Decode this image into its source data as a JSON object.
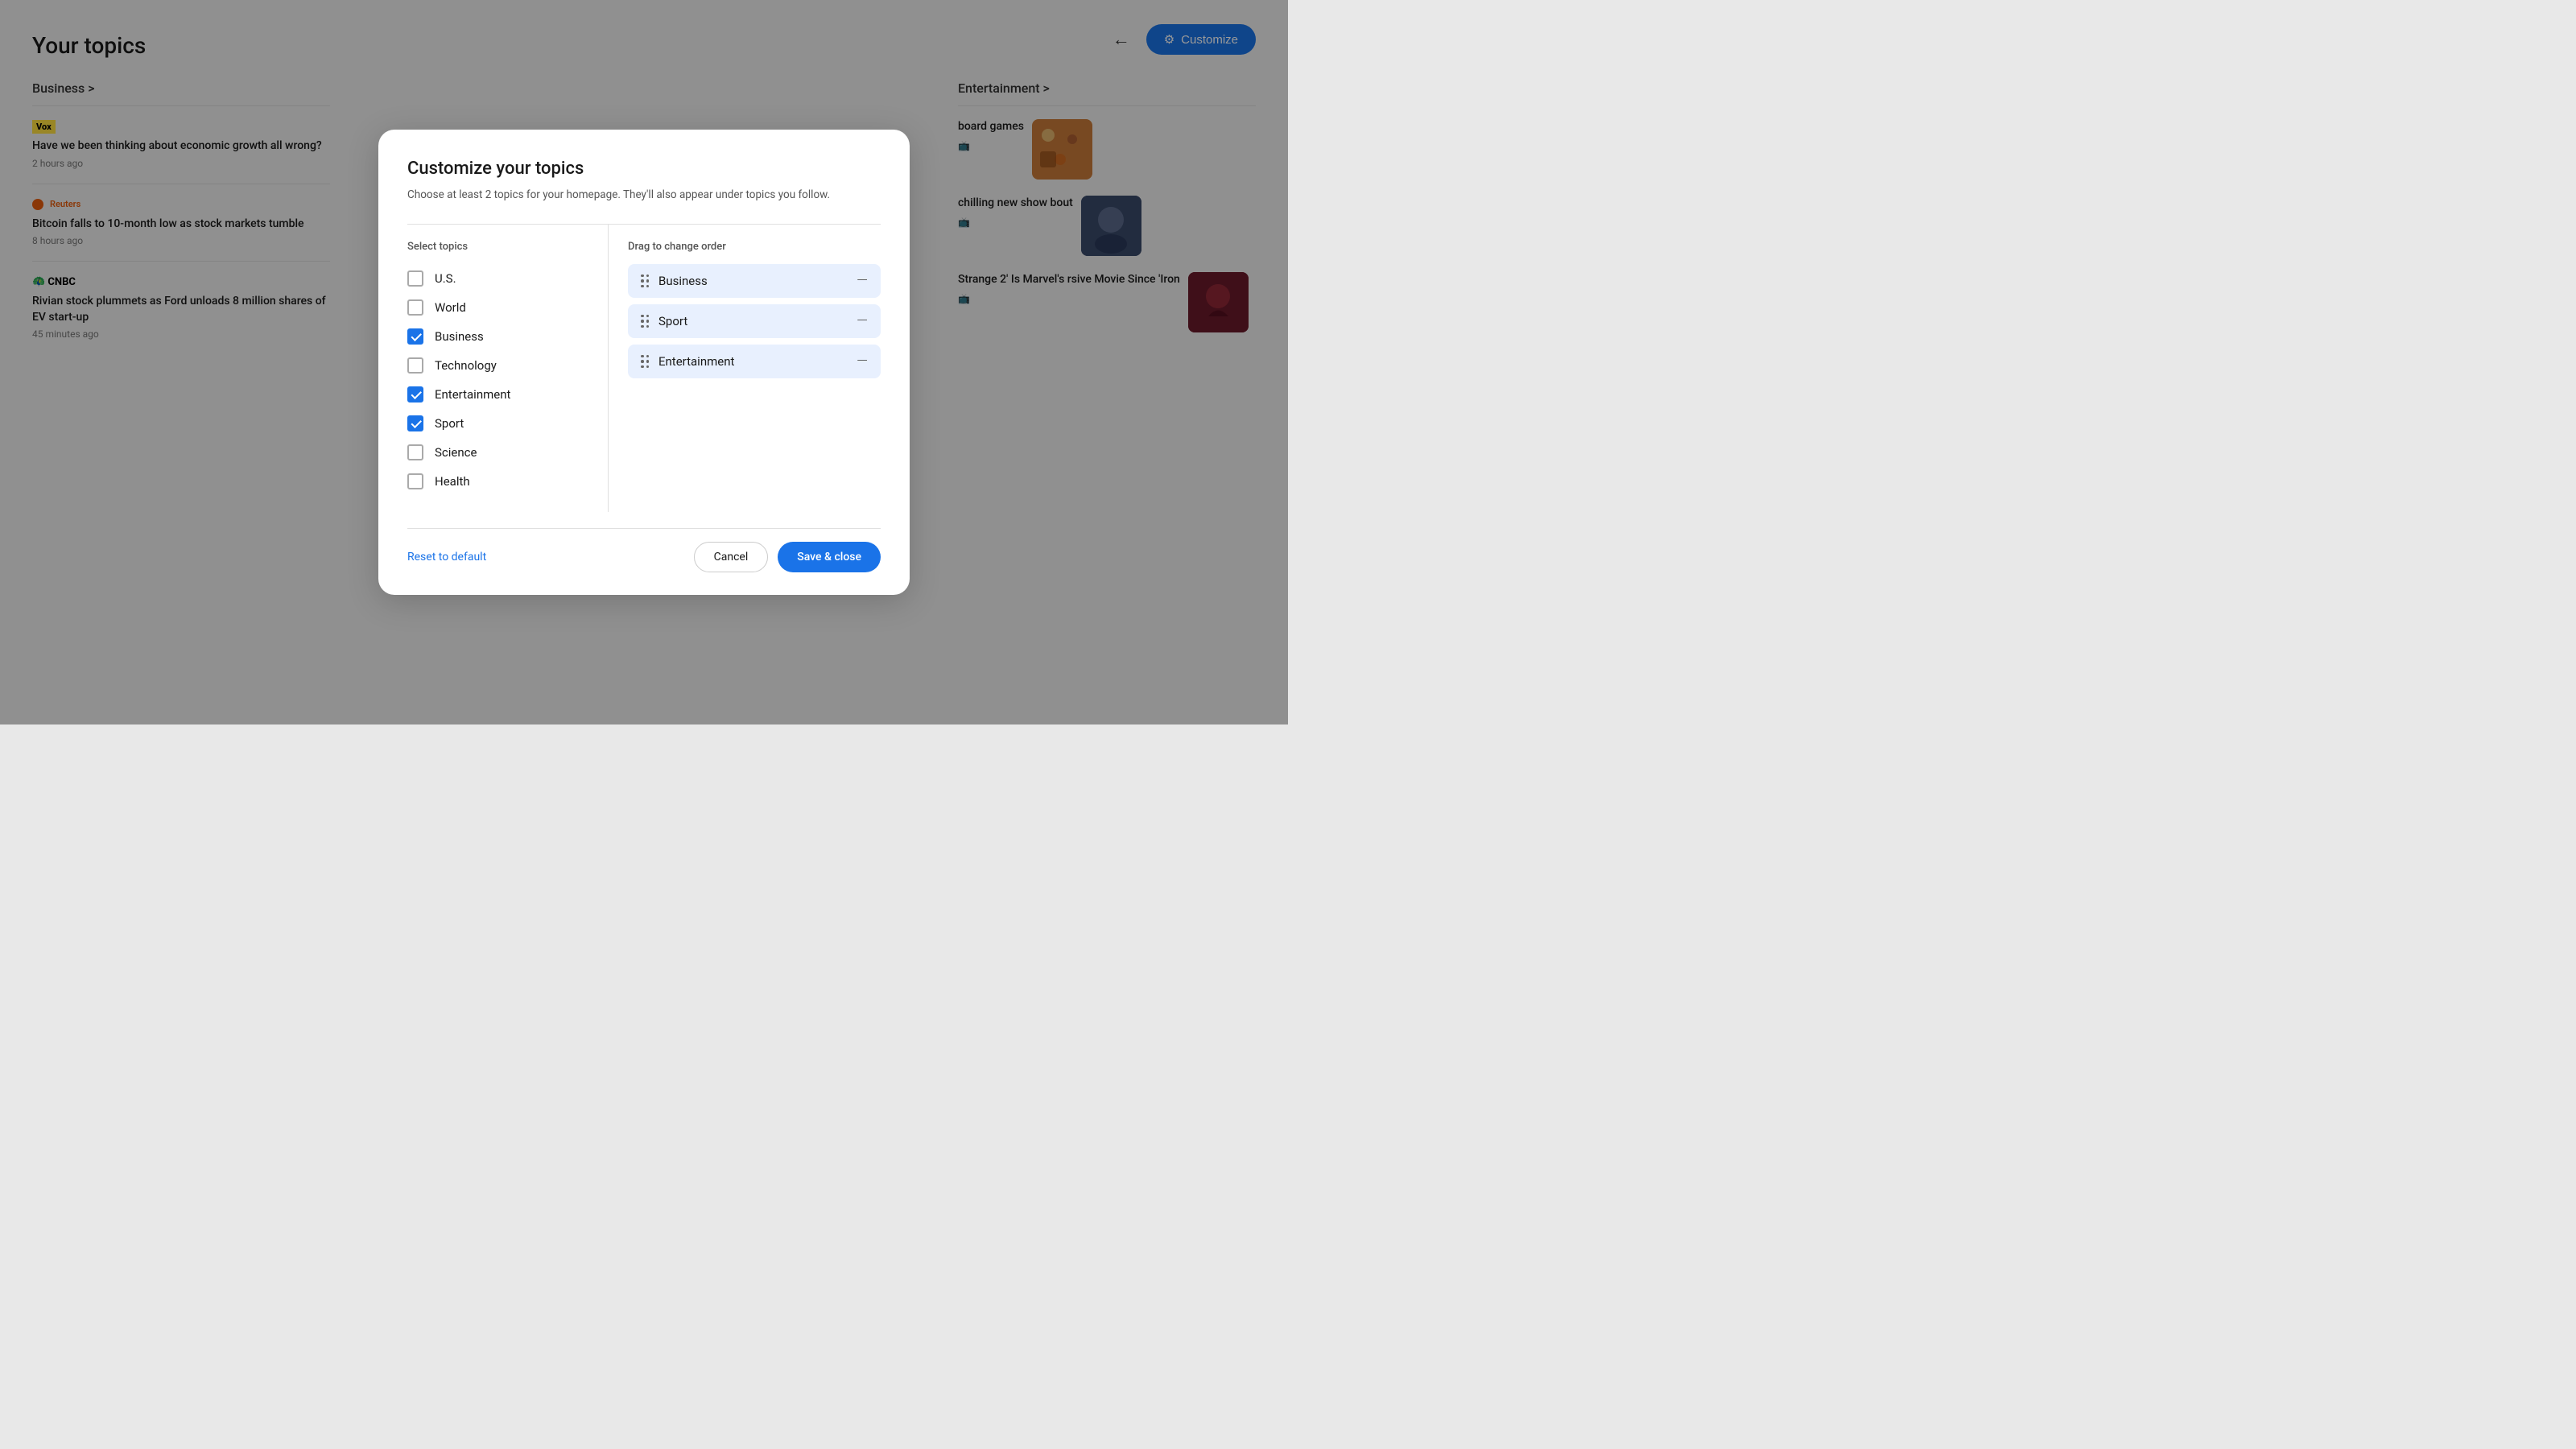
{
  "page": {
    "title": "Your topics"
  },
  "header": {
    "back_label": "←",
    "customize_icon": "⚙",
    "customize_label": "Customize"
  },
  "bg_left": {
    "section_label": "Business",
    "news_items": [
      {
        "source": "Vox",
        "source_type": "vox",
        "title": "Have we been thinking about economic growth all wrong?",
        "time": "2 hours ago"
      },
      {
        "source": "Reuters",
        "source_type": "reuters",
        "title": "Bitcoin falls to 10-month low as stock markets tumble",
        "time": "8 hours ago"
      },
      {
        "source": "CNBC",
        "source_type": "cnbc",
        "title": "Rivian stock plummets as Ford unloads 8 million shares of EV start-up",
        "time": "45 minutes ago"
      }
    ]
  },
  "bg_right": {
    "section_label": "Entertainment >",
    "news_items": [
      {
        "text": "board games",
        "thumb_type": "board"
      },
      {
        "text": "chilling new show bout",
        "thumb_type": "show"
      },
      {
        "text": "Strange 2' Is Marvel's rsive Movie Since 'Iron",
        "thumb_type": "marvel"
      }
    ]
  },
  "modal": {
    "title": "Customize your topics",
    "subtitle": "Choose at least 2 topics for your homepage. They'll also appear under topics you follow.",
    "left_header": "Select topics",
    "right_header": "Drag to change order",
    "topics": [
      {
        "id": "us",
        "label": "U.S.",
        "checked": false
      },
      {
        "id": "world",
        "label": "World",
        "checked": false
      },
      {
        "id": "business",
        "label": "Business",
        "checked": true
      },
      {
        "id": "technology",
        "label": "Technology",
        "checked": false
      },
      {
        "id": "entertainment",
        "label": "Entertainment",
        "checked": true
      },
      {
        "id": "sport",
        "label": "Sport",
        "checked": true
      },
      {
        "id": "science",
        "label": "Science",
        "checked": false
      },
      {
        "id": "health",
        "label": "Health",
        "checked": false
      }
    ],
    "order_items": [
      {
        "label": "Business"
      },
      {
        "label": "Sport"
      },
      {
        "label": "Entertainment"
      }
    ],
    "reset_label": "Reset to default",
    "cancel_label": "Cancel",
    "save_label": "Save & close"
  }
}
